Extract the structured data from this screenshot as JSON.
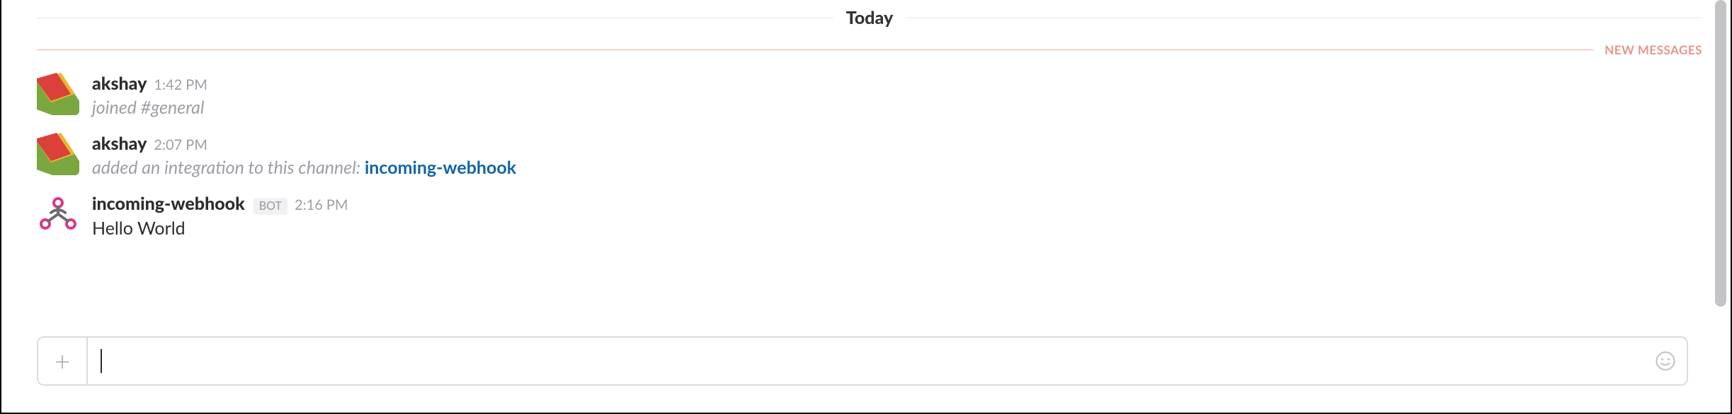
{
  "dayLabel": "Today",
  "newMessagesLabel": "NEW MESSAGES",
  "messages": [
    {
      "author": "akshay",
      "time": "1:42 PM",
      "system_prefix": "joined ",
      "system_channel": "#general",
      "system_suffix": "",
      "link_text": "",
      "plain_text": ""
    },
    {
      "author": "akshay",
      "time": "2:07 PM",
      "system_prefix": "added an integration to this channel: ",
      "system_channel": "",
      "system_suffix": "",
      "link_text": "incoming-webhook",
      "plain_text": ""
    },
    {
      "author": "incoming-webhook",
      "time": "2:16 PM",
      "bot_badge": "BOT",
      "plain_text": "Hello World"
    }
  ],
  "composer": {
    "placeholder": ""
  }
}
